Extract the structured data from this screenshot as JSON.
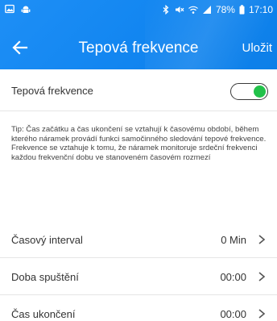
{
  "status_bar": {
    "battery": "78%",
    "time": "17:10",
    "icons": [
      "gallery-icon",
      "android-icon",
      "bluetooth-icon",
      "mute-icon",
      "wifi-icon",
      "signal-icon",
      "battery-icon"
    ]
  },
  "header": {
    "title": "Tepová frekvence",
    "save_label": "Uložit",
    "back_icon": "back-arrow-icon",
    "color": "#1488f2"
  },
  "toggle_row": {
    "label": "Tepová frekvence",
    "enabled": true,
    "on_color": "#22c24a"
  },
  "tip": "Tip: Čas začátku a čas ukončení se vztahují k časovému období, během kterého náramek provádí funkci samočinného sledování tepové frekvence. Frekvence se vztahuje k tomu, že náramek monitoruje srdeční frekvenci každou frekvenční dobu ve stanoveném časovém rozmezí",
  "settings": [
    {
      "label": "Časový interval",
      "value": "0 Min"
    },
    {
      "label": "Doba spuštění",
      "value": "00:00"
    },
    {
      "label": "Čas ukončení",
      "value": "00:00"
    }
  ]
}
